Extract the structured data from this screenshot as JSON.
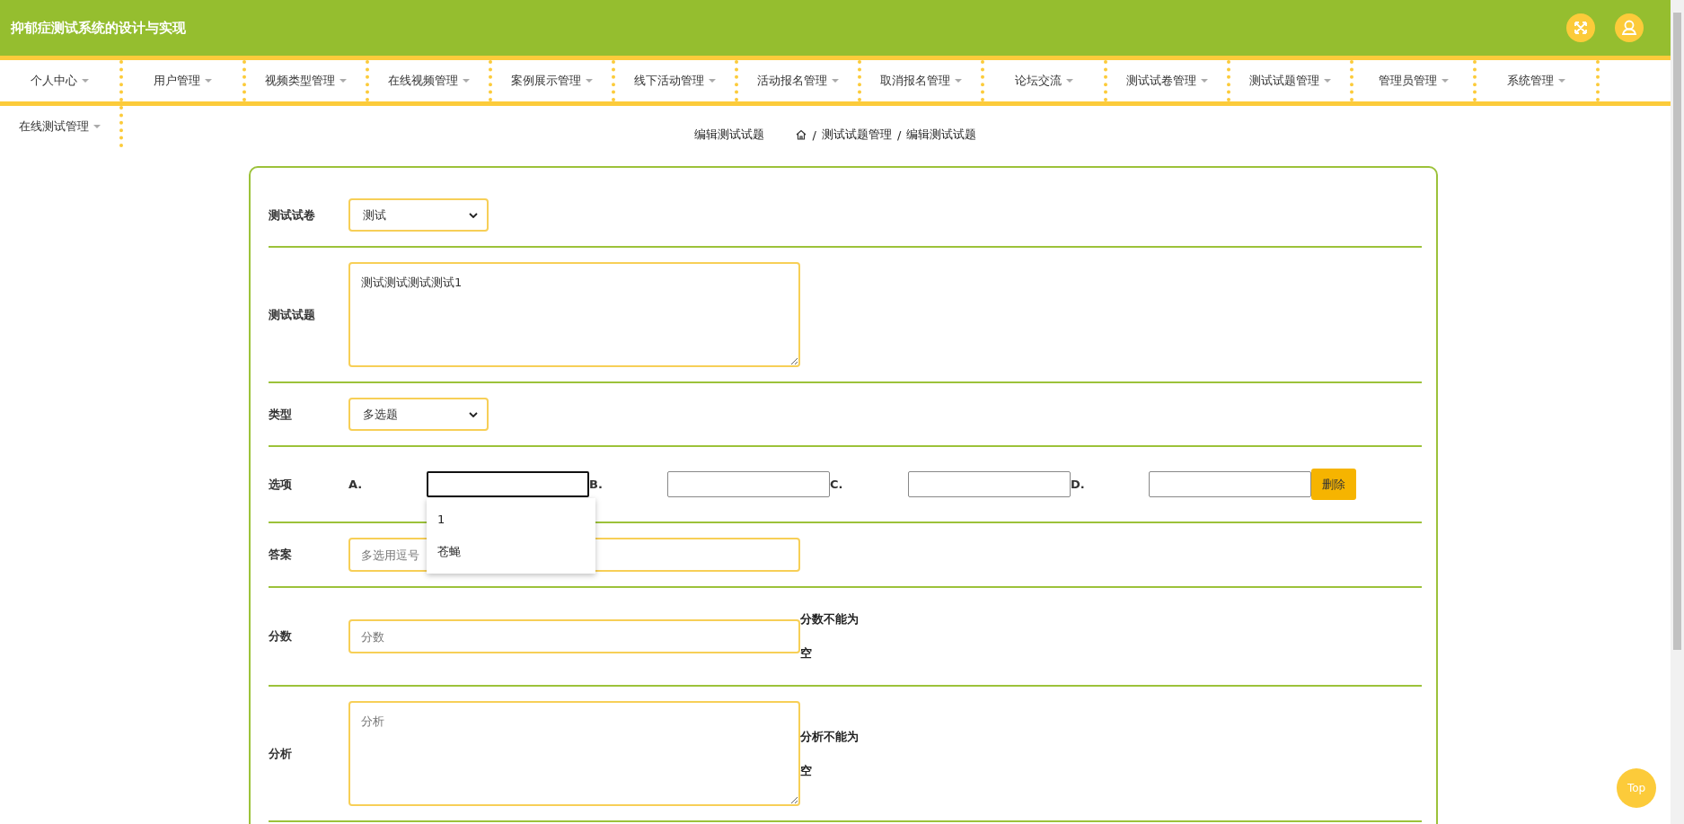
{
  "header": {
    "title": "抑郁症测试系统的设计与实现"
  },
  "nav": {
    "items": [
      {
        "label": "个人中心"
      },
      {
        "label": "用户管理"
      },
      {
        "label": "视频类型管理"
      },
      {
        "label": "在线视频管理"
      },
      {
        "label": "案例展示管理"
      },
      {
        "label": "线下活动管理"
      },
      {
        "label": "活动报名管理"
      },
      {
        "label": "取消报名管理"
      },
      {
        "label": "论坛交流"
      },
      {
        "label": "测试试卷管理"
      },
      {
        "label": "测试试题管理"
      },
      {
        "label": "管理员管理"
      },
      {
        "label": "系统管理"
      },
      {
        "label": "在线测试管理"
      }
    ]
  },
  "page_title": "编辑测试试题",
  "breadcrumb": {
    "separator": "/",
    "items": [
      "测试试题管理",
      "编辑测试试题"
    ]
  },
  "form": {
    "paper": {
      "label": "测试试卷",
      "value": "测试"
    },
    "question": {
      "label": "测试试题",
      "value": "测试测试测试测试1"
    },
    "type": {
      "label": "类型",
      "value": "多选题"
    },
    "options": {
      "label": "选项",
      "items": [
        {
          "letter": "A.",
          "focused": true
        },
        {
          "letter": "B.",
          "focused": false
        },
        {
          "letter": "C.",
          "focused": false
        },
        {
          "letter": "D.",
          "focused": false
        }
      ],
      "delete": "删除",
      "suggestions": [
        "1",
        "苍蝇"
      ]
    },
    "answer": {
      "label": "答案",
      "placeholder": "多选用逗号"
    },
    "score": {
      "label": "分数",
      "placeholder": "分数",
      "error": "分数不能为空"
    },
    "analysis": {
      "label": "分析",
      "placeholder": "分析",
      "error": "分析不能为空"
    }
  },
  "top_button": "Top"
}
